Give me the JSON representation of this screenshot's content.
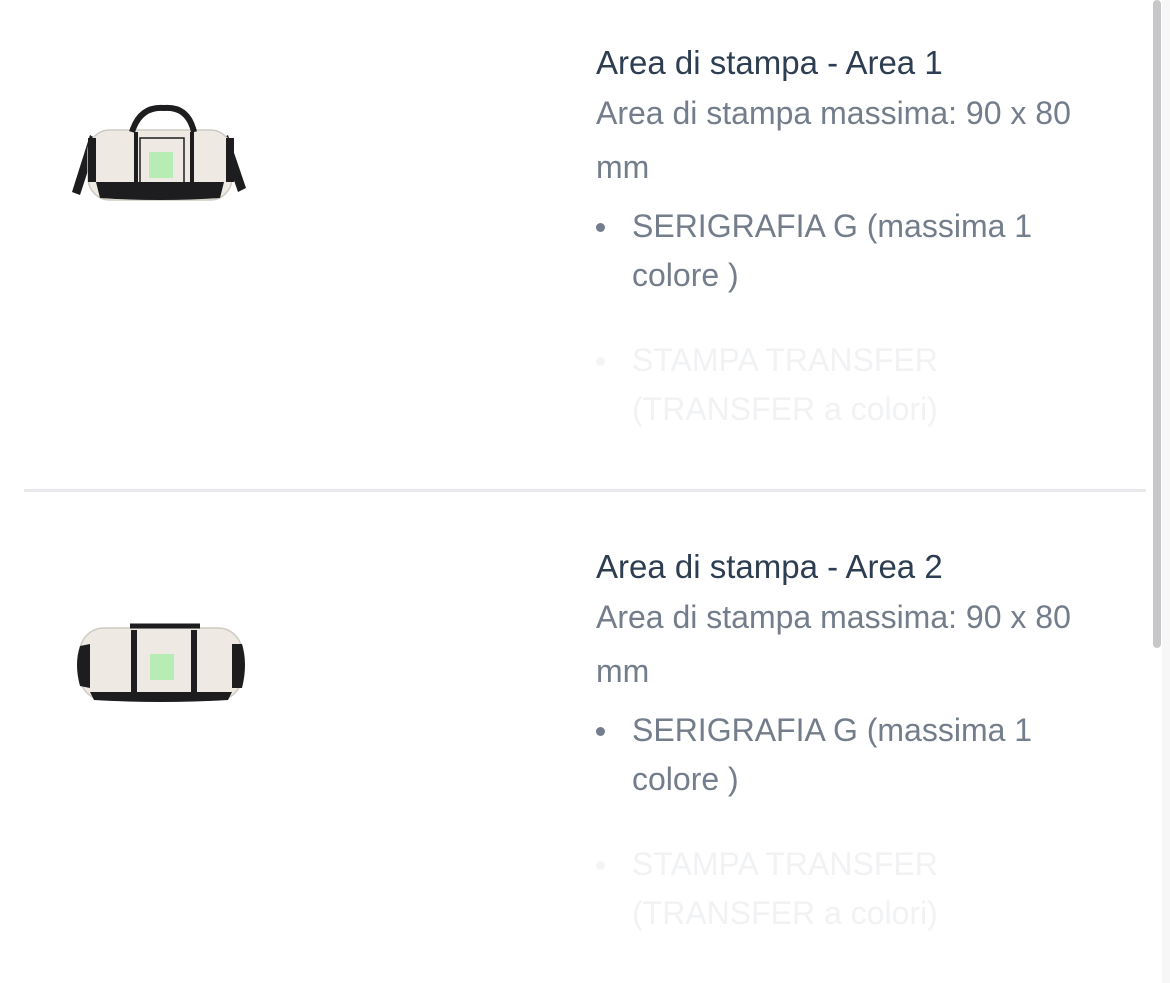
{
  "print_areas": [
    {
      "title": "Area di stampa - Area 1",
      "max_area": "Area di stampa massima: 90 x 80 mm",
      "techniques": [
        {
          "label": "SERIGRAFIA G (massima 1 colore )"
        },
        {
          "label": "STAMPA TRANSFER (TRANSFER a colori)"
        }
      ]
    },
    {
      "title": "Area di stampa - Area 2",
      "max_area": "Area di stampa massima: 90 x 80 mm",
      "techniques": [
        {
          "label": "SERIGRAFIA G (massima 1 colore )"
        },
        {
          "label": "STAMPA TRANSFER (TRANSFER a colori)"
        }
      ]
    }
  ],
  "colors": {
    "print_zone": "#b7ecb4",
    "bag_body": "#eeeae3",
    "bag_trim": "#1d1d1f",
    "title_text": "#2e3e52",
    "body_text": "#737d8b"
  }
}
